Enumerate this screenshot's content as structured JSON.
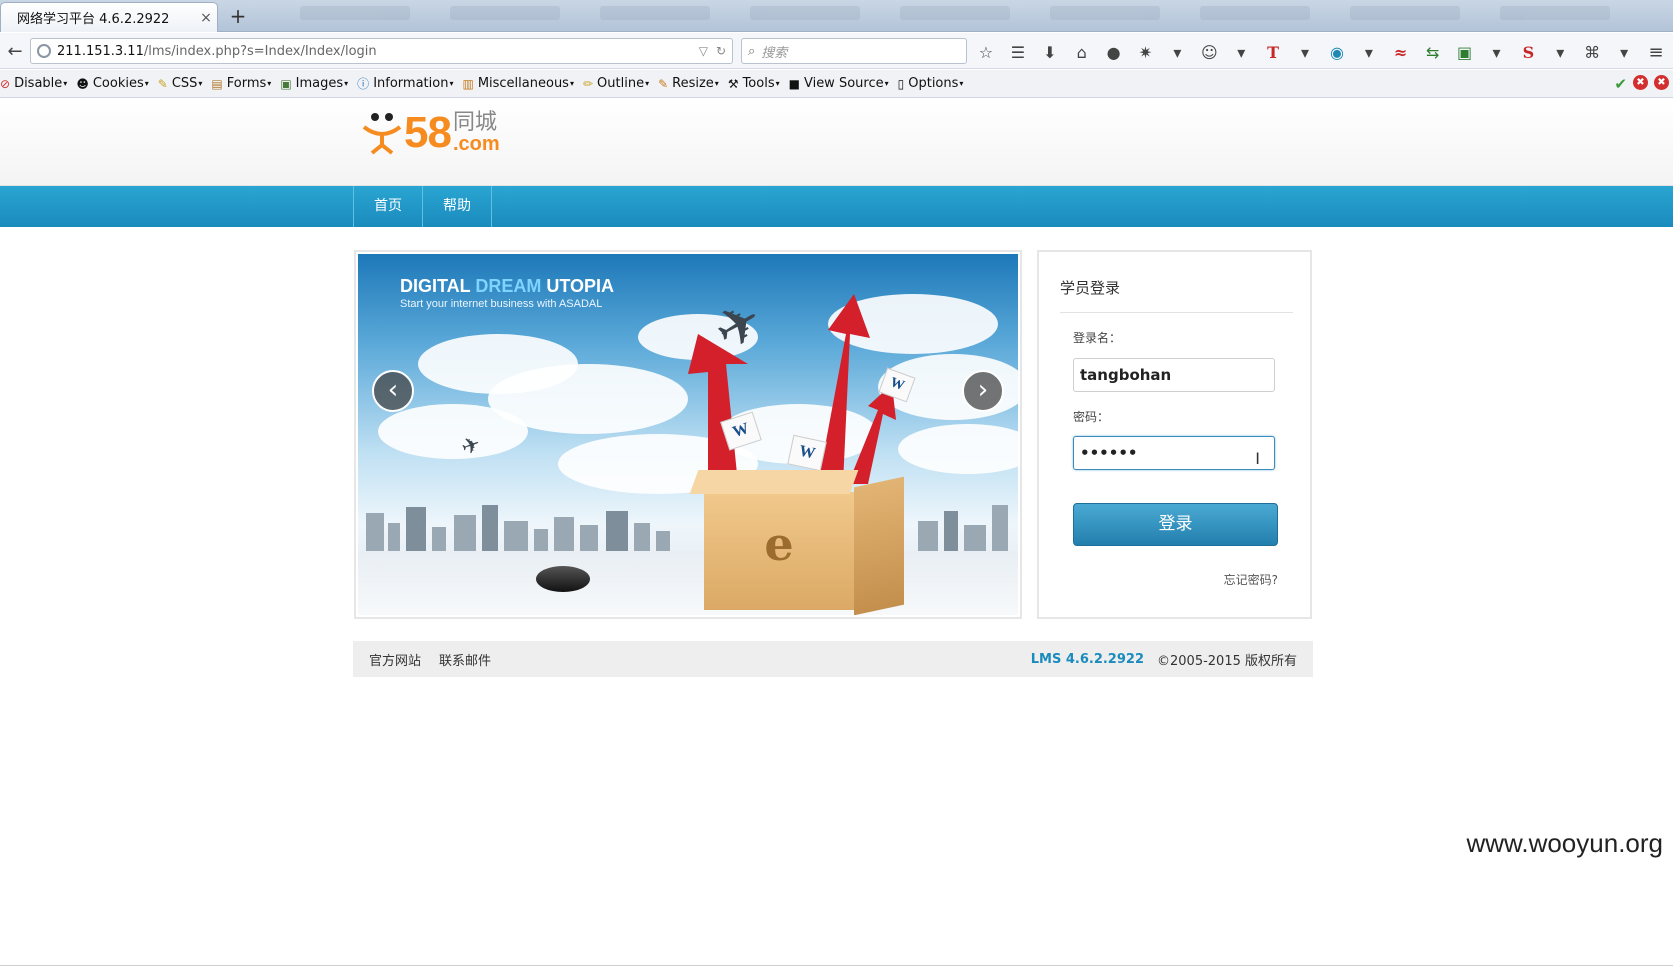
{
  "browser": {
    "tab_title": "网络学习平台 4.6.2.2922",
    "tab_close": "×",
    "new_tab": "+",
    "url_host": "211.151.3.11",
    "url_path": "/lms/index.php?s=Index/Index/login",
    "search_placeholder": "搜索"
  },
  "devbar": {
    "items": [
      "Disable",
      "Cookies",
      "CSS",
      "Forms",
      "Images",
      "Information",
      "Miscellaneous",
      "Outline",
      "Resize",
      "Tools",
      "View Source",
      "Options"
    ]
  },
  "site": {
    "logo_number": "58",
    "logo_cn": "同城",
    "logo_com": ".com",
    "nav": [
      "首页",
      "帮助"
    ]
  },
  "banner": {
    "title_part1": "DIGITAL ",
    "title_part2": "DREAM",
    "title_part3": " UTOPIA",
    "subtitle": "Start your internet business with ASADAL",
    "prev": "‹",
    "next": "›"
  },
  "login": {
    "title": "学员登录",
    "username_label": "登录名：",
    "username_value": "tangbohan",
    "password_label": "密码：",
    "password_value": "••••••",
    "submit": "登录",
    "forgot": "忘记密码?"
  },
  "footer": {
    "links": [
      "官方网站",
      "联系邮件"
    ],
    "version": "LMS 4.6.2.2922",
    "copyright": "©2005-2015 版权所有"
  },
  "watermark": "www.wooyun.org"
}
